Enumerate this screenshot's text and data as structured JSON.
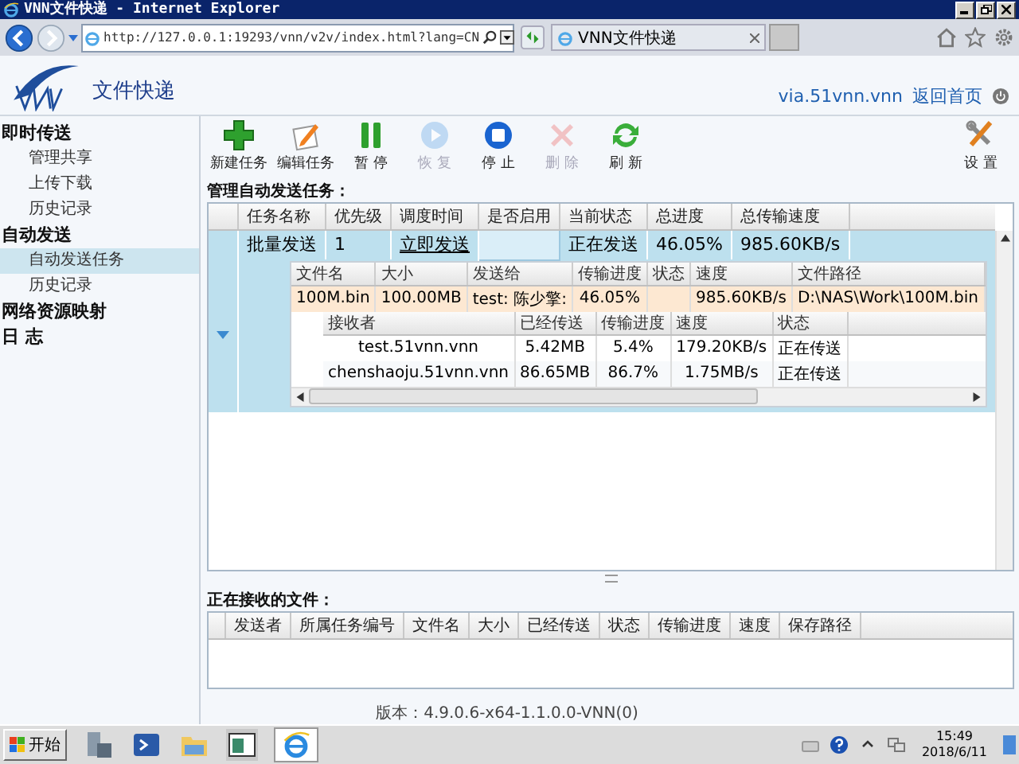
{
  "window": {
    "title": "VNN文件快递 - Internet Explorer"
  },
  "browser": {
    "url": "http://127.0.0.1:19293/vnn/v2v/index.html?lang=CN",
    "tab_title": "VNN文件快递"
  },
  "header": {
    "site_title": "文件快递",
    "links": [
      "via.51vnn.vnn",
      "返回首页"
    ]
  },
  "sidebar": {
    "groups": [
      {
        "label": "即时传送",
        "items": [
          {
            "label": "管理共享",
            "selected": false
          },
          {
            "label": "上传下载",
            "selected": false
          },
          {
            "label": "历史记录",
            "selected": false
          }
        ]
      },
      {
        "label": "自动发送",
        "items": [
          {
            "label": "自动发送任务",
            "selected": true
          },
          {
            "label": "历史记录",
            "selected": false
          }
        ]
      },
      {
        "label": "网络资源映射"
      },
      {
        "label": "日 志"
      }
    ]
  },
  "toolbar": {
    "buttons": [
      {
        "kind": "add",
        "label": "新建任务",
        "disabled": false
      },
      {
        "kind": "edit",
        "label": "编辑任务",
        "disabled": false
      },
      {
        "kind": "pause",
        "label": "暂 停",
        "disabled": false
      },
      {
        "kind": "resume",
        "label": "恢 复",
        "disabled": true
      },
      {
        "kind": "stop",
        "label": "停 止",
        "disabled": false
      },
      {
        "kind": "delete",
        "label": "删 除",
        "disabled": true
      },
      {
        "kind": "refresh",
        "label": "刷 新",
        "disabled": false
      }
    ],
    "settings": {
      "label": "设 置"
    }
  },
  "tasks": {
    "title": "管理自动发送任务：",
    "columns": [
      "任务名称",
      "优先级",
      "调度时间",
      "是否启用",
      "当前状态",
      "总进度",
      "总传输速度"
    ],
    "rows": [
      {
        "selected": true,
        "expanded": true,
        "cells": [
          {
            "text": "批量发送",
            "focused": false
          },
          {
            "text": "1",
            "focused": false
          },
          {
            "text": "立即发送",
            "focused": false
          },
          {
            "focused": true
          },
          {
            "text": "正在发送",
            "focused": false
          },
          {
            "text": "46.05%",
            "focused": false
          },
          {
            "text": "985.60KB/s",
            "focused": false
          }
        ],
        "files": {
          "columns": [
            "文件名",
            "大小",
            "发送给",
            "传输进度",
            "状态",
            "速度",
            "文件路径"
          ],
          "rows": [
            [
              "100M.bin",
              "100.00MB",
              "test: 陈少擎:",
              "46.05%",
              "",
              "985.60KB/s",
              "D:\\NAS\\Work\\100M.bin"
            ]
          ]
        },
        "receivers": {
          "columns": [
            "接收者",
            "已经传送",
            "传输进度",
            "速度",
            "状态"
          ],
          "rows": [
            [
              "test.51vnn.vnn",
              "5.42MB",
              "5.4%",
              "179.20KB/s",
              "正在传送"
            ],
            [
              "chenshaoju.51vnn.vnn",
              "86.65MB",
              "86.7%",
              "1.75MB/s",
              "正在传送"
            ]
          ]
        }
      }
    ]
  },
  "receiving": {
    "title": "正在接收的文件：",
    "columns": [
      "发送者",
      "所属任务编号",
      "文件名",
      "大小",
      "已经传送",
      "状态",
      "传输进度",
      "速度",
      "保存路径"
    ]
  },
  "version": "版本：4.9.0.6-x64-1.1.0.0-VNN(0)",
  "taskbar": {
    "start_label": "开始",
    "time": "15:49",
    "date": "2018/6/11"
  }
}
